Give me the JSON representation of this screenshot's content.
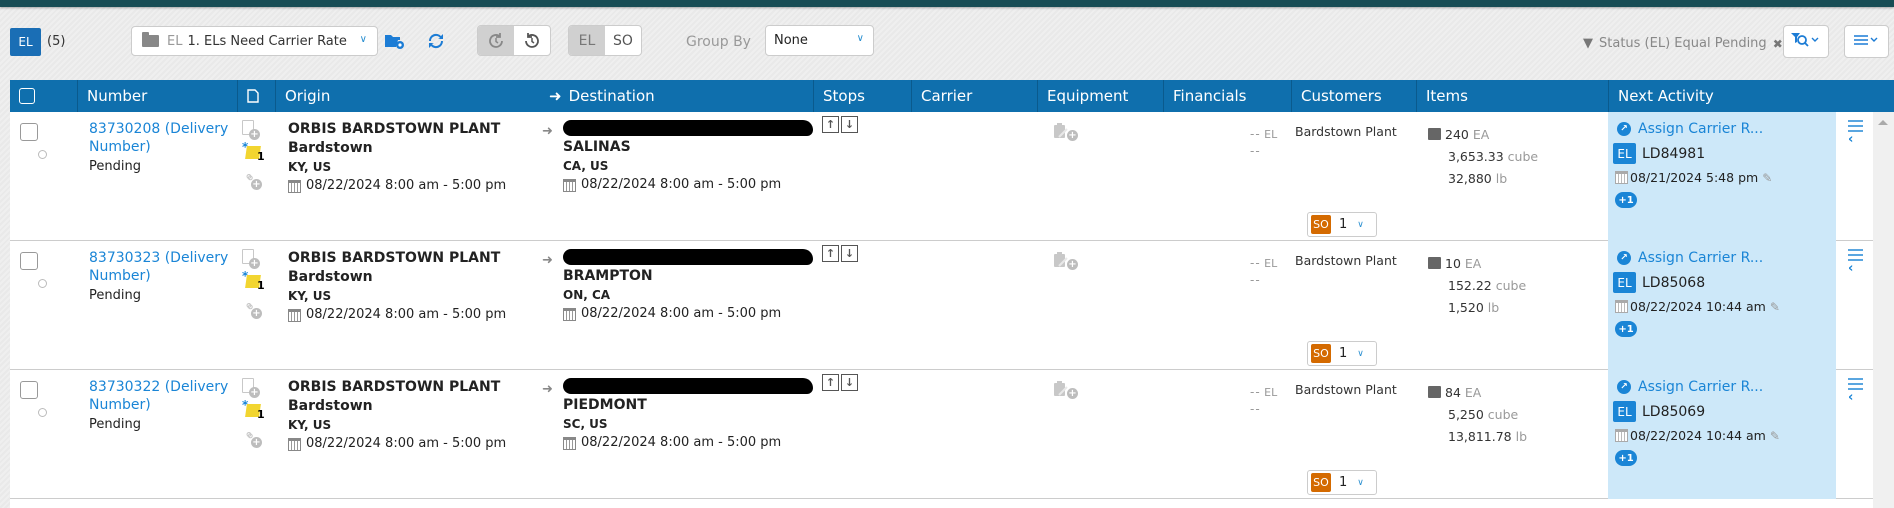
{
  "toolbar": {
    "entity_badge": "EL",
    "record_count": "(5)",
    "view": {
      "prefix": "EL",
      "name": "1. ELs Need Carrier Rate",
      "icon": "folder-icon"
    },
    "history_toggle": {
      "options": [
        "current",
        "history"
      ],
      "active": "current"
    },
    "entity_toggle": {
      "options": [
        "EL",
        "SO"
      ],
      "active": "EL"
    },
    "group_by_label": "Group By",
    "group_by_value": "None",
    "filter": {
      "text": "Status (EL) Equal Pending",
      "remove_icon": "close-icon"
    }
  },
  "grid": {
    "columns": [
      "Number",
      "",
      "Origin",
      "Destination",
      "Stops",
      "Carrier",
      "Equipment",
      "Financials",
      "Customers",
      "Items",
      "Next Activity"
    ],
    "rows": [
      {
        "number": "83730208 (Delivery Number)",
        "status": "Pending",
        "note_count": "1",
        "origin": {
          "name": "ORBIS BARDSTOWN PLANT",
          "city": "Bardstown",
          "state": "KY, US",
          "window": "08/22/2024 8:00 am - 5:00 pm"
        },
        "destination": {
          "name": "[redacted]",
          "city": "SALINAS",
          "state": "CA, US",
          "window": "08/22/2024 8:00 am - 5:00 pm"
        },
        "financials": {
          "line1": "--",
          "line1_unit": "EL",
          "line2": "--"
        },
        "customer": "Bardstown Plant",
        "so": {
          "tag": "SO",
          "value": "1"
        },
        "items": {
          "qty": "240",
          "qty_unit": "EA",
          "cube": "3,653.33",
          "cube_unit": "cube",
          "weight": "32,880",
          "weight_unit": "lb"
        },
        "next_activity": {
          "title": "Assign Carrier R...",
          "entity": "EL",
          "load": "LD84981",
          "datetime": "08/21/2024 5:48 pm",
          "more": "+1"
        }
      },
      {
        "number": "83730323 (Delivery Number)",
        "status": "Pending",
        "note_count": "1",
        "origin": {
          "name": "ORBIS BARDSTOWN PLANT",
          "city": "Bardstown",
          "state": "KY, US",
          "window": "08/22/2024 8:00 am - 5:00 pm"
        },
        "destination": {
          "name": "[redacted]",
          "city": "BRAMPTON",
          "state": "ON, CA",
          "window": "08/22/2024 8:00 am - 5:00 pm"
        },
        "financials": {
          "line1": "--",
          "line1_unit": "EL",
          "line2": "--"
        },
        "customer": "Bardstown Plant",
        "so": {
          "tag": "SO",
          "value": "1"
        },
        "items": {
          "qty": "10",
          "qty_unit": "EA",
          "cube": "152.22",
          "cube_unit": "cube",
          "weight": "1,520",
          "weight_unit": "lb"
        },
        "next_activity": {
          "title": "Assign Carrier R...",
          "entity": "EL",
          "load": "LD85068",
          "datetime": "08/22/2024 10:44 am",
          "more": "+1"
        }
      },
      {
        "number": "83730322 (Delivery Number)",
        "status": "Pending",
        "note_count": "1",
        "origin": {
          "name": "ORBIS BARDSTOWN PLANT",
          "city": "Bardstown",
          "state": "KY, US",
          "window": "08/22/2024 8:00 am - 5:00 pm"
        },
        "destination": {
          "name": "[redacted]",
          "city": "PIEDMONT",
          "state": "SC, US",
          "window": "08/22/2024 8:00 am - 5:00 pm"
        },
        "financials": {
          "line1": "--",
          "line1_unit": "EL",
          "line2": "--"
        },
        "customer": "Bardstown Plant",
        "so": {
          "tag": "SO",
          "value": "1"
        },
        "items": {
          "qty": "84",
          "qty_unit": "EA",
          "cube": "5,250",
          "cube_unit": "cube",
          "weight": "13,811.78",
          "weight_unit": "lb"
        },
        "next_activity": {
          "title": "Assign Carrier R...",
          "entity": "EL",
          "load": "LD85069",
          "datetime": "08/22/2024 10:44 am",
          "more": "+1"
        }
      }
    ]
  },
  "colors": {
    "header_bg": "#0f6fad",
    "link": "#1a85d6",
    "next_activity_bg": "#cde8f9",
    "so_tag": "#d46a00",
    "top_bar": "#184d55"
  }
}
